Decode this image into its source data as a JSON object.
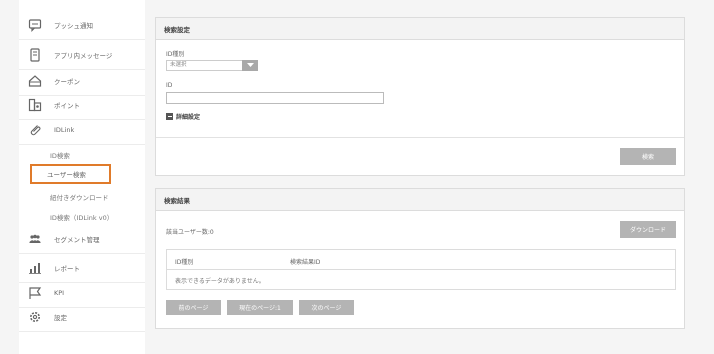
{
  "sidebar": {
    "items": [
      {
        "label": "プッシュ通知",
        "icon": "chat-bubble-icon"
      },
      {
        "label": "アプリ内メッセージ",
        "icon": "mobile-phone-icon"
      },
      {
        "label": "クーポン",
        "icon": "coupon-tag-icon"
      },
      {
        "label": "ポイント",
        "icon": "points-card-icon"
      },
      {
        "label": "IDLink",
        "icon": "link-icon"
      },
      {
        "label": "セグメント管理",
        "icon": "users-group-icon"
      },
      {
        "label": "レポート",
        "icon": "bar-chart-icon"
      },
      {
        "label": "KPI",
        "icon": "flag-icon"
      },
      {
        "label": "設定",
        "icon": "gear-icon"
      }
    ],
    "idlink_subitems": [
      {
        "label": "ID検索"
      },
      {
        "label": "ユーザー検索"
      },
      {
        "label": "紐付きダウンロード"
      },
      {
        "label": "ID検索（IDLink v0）"
      }
    ]
  },
  "search_panel": {
    "title": "検索設定",
    "id_type_label": "ID種別",
    "id_type_value": "未選択",
    "id_label": "ID",
    "id_value": "",
    "detail_label": "詳細設定",
    "search_button": "検索"
  },
  "results_panel": {
    "title": "検索結果",
    "count_text": "該当ユーザー数:0",
    "download_button": "ダウンロード",
    "columns": [
      "ID種別",
      "検索結果ID"
    ],
    "empty_message": "表示できるデータがありません。",
    "prev_button": "前のページ",
    "current_page": "現在のページ:1",
    "next_button": "次のページ"
  },
  "colors": {
    "highlight": "#e07b2a",
    "button_gray": "#b4b4b4"
  }
}
